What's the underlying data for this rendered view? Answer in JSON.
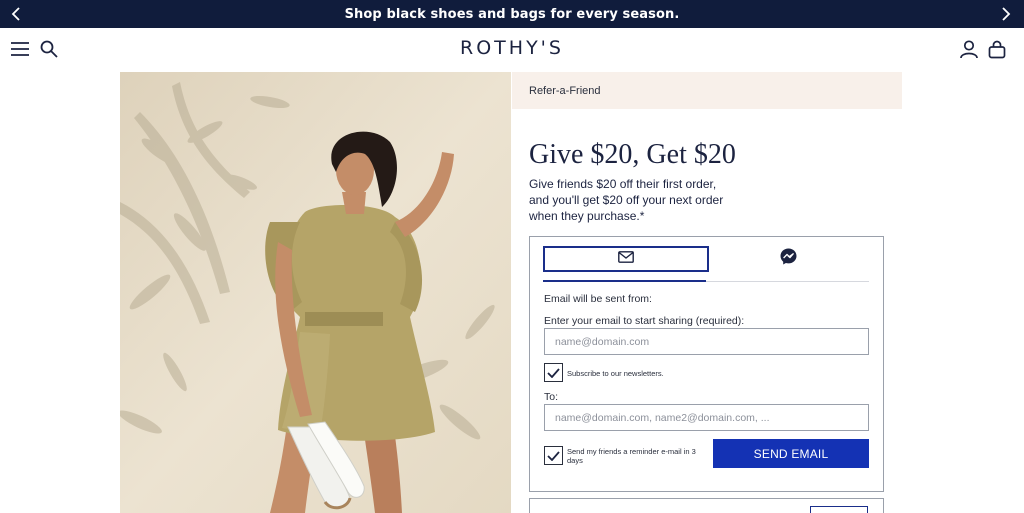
{
  "announcement": {
    "text": "Shop black shoes and bags for every season."
  },
  "header": {
    "logo": "ROTHY'S"
  },
  "hero": {
    "image_alt": "Woman in khaki dress holding white sneakers"
  },
  "referral": {
    "bar_label": "Refer-a-Friend",
    "headline": "Give $20, Get $20",
    "description": "Give friends $20 off their first order, and you'll get $20 off your next order when they purchase.*",
    "form": {
      "sent_from_label": "Email will be sent from:",
      "your_email_label": "Enter your email to start sharing (required):",
      "your_email_placeholder": "name@domain.com",
      "subscribe_label": "Subscribe to our newsletters.",
      "subscribe_checked": true,
      "to_label": "To:",
      "to_placeholder": "name@domain.com, name2@domain.com, ...",
      "reminder_label": "Send my friends a reminder e-mail in 3 days",
      "reminder_checked": true,
      "send_button": "SEND EMAIL"
    }
  },
  "colors": {
    "navy": "#101c3c",
    "accent_blue": "#1432b4",
    "referral_bar_bg": "#f8f0ea"
  }
}
